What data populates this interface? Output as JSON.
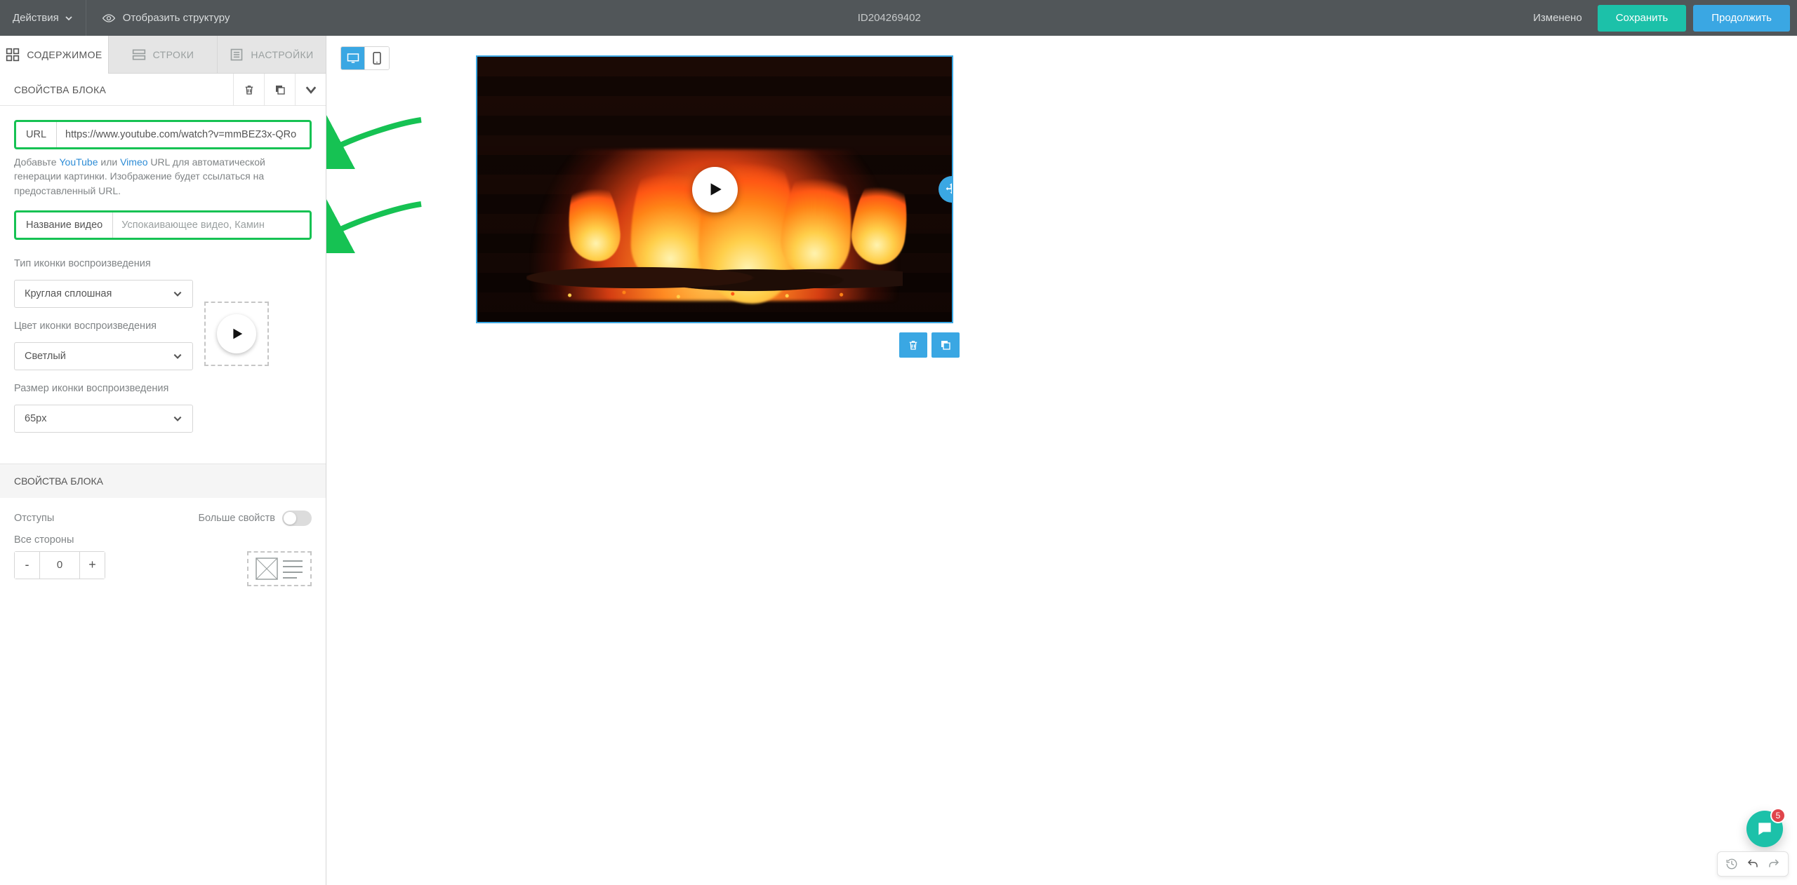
{
  "topbar": {
    "actions": "Действия",
    "show_structure": "Отобразить структуру",
    "id": "ID204269402",
    "status": "Изменено",
    "save": "Сохранить",
    "continue": "Продолжить"
  },
  "tabs": {
    "content": "СОДЕРЖИМОЕ",
    "rows": "СТРОКИ",
    "settings": "НАСТРОЙКИ"
  },
  "block": {
    "title": "СВОЙСТВА БЛОКА",
    "url_label": "URL",
    "url_value": "https://www.youtube.com/watch?v=mmBEZ3x-QRo",
    "url_help_prefix": "Добавьте ",
    "url_help_yt": "YouTube",
    "url_help_or": " или ",
    "url_help_vimeo": "Vimeo",
    "url_help_suffix": " URL для автоматической генерации картинки. Изображение будет ссылаться на предоставленный URL.",
    "title_label": "Название видео",
    "title_placeholder": "Успокаивающее видео, Камин",
    "icon_type_label": "Тип иконки воспроизведения",
    "icon_type_value": "Круглая сплошная",
    "icon_color_label": "Цвет иконки воспроизведения",
    "icon_color_value": "Светлый",
    "icon_size_label": "Размер иконки воспроизведения",
    "icon_size_value": "65px",
    "title2": "СВОЙСТВА БЛОКА",
    "paddings_label": "Отступы",
    "more_props": "Больше свойств",
    "all_sides": "Все стороны",
    "padding_value": "0"
  },
  "chat_badge": "5"
}
